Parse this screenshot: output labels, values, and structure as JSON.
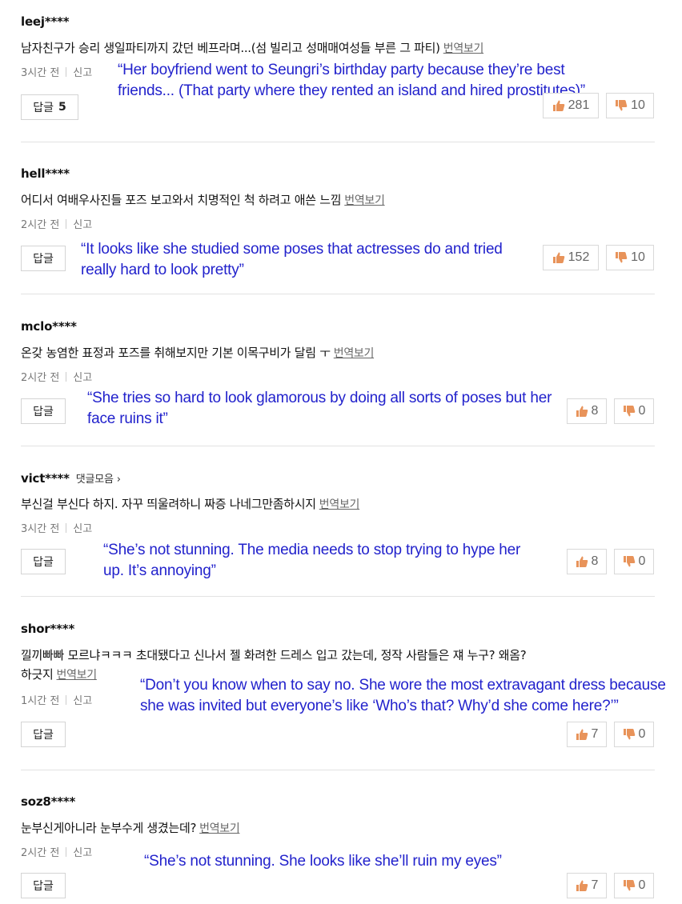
{
  "comments": [
    {
      "author": "leej****",
      "collect_label": "",
      "text_line1": "남자친구가 승리 생일파티까지 갔던 베프라며...(섬 빌리고 성매매여성들 부른 그 파티)",
      "text_line2": "",
      "translate_label": "번역보기",
      "time": "3시간 전",
      "report_label": "신고",
      "reply_label": "답글",
      "reply_count": "5",
      "english": "“Her boyfriend went to Seungri’s birthday party because they’re best friends... (That party where they rented an island and hired prostitutes)”",
      "likes": "281",
      "dislikes": "10"
    },
    {
      "author": "hell****",
      "collect_label": "",
      "text_line1": "어디서 여배우사진들 포즈 보고와서 치명적인 척 하려고 애쓴 느낌",
      "text_line2": "",
      "translate_label": "번역보기",
      "time": "2시간 전",
      "report_label": "신고",
      "reply_label": "답글",
      "reply_count": "",
      "english": "“It looks like she studied some poses that actresses do and tried really hard to look pretty”",
      "likes": "152",
      "dislikes": "10"
    },
    {
      "author": "mclo****",
      "collect_label": "",
      "text_line1": "온갖 농염한 표정과 포즈를 취해보지만 기본 이목구비가 달림 ㅜ",
      "text_line2": "",
      "translate_label": "번역보기",
      "time": "2시간 전",
      "report_label": "신고",
      "reply_label": "답글",
      "reply_count": "",
      "english": "“She tries so hard to look glamorous by doing all sorts of poses but her face ruins it”",
      "likes": "8",
      "dislikes": "0"
    },
    {
      "author": "vict****",
      "collect_label": "댓글모음 ›",
      "text_line1": "부신걸 부신다 하지. 자꾸 띄울려하니 짜증 나네그만좀하시지",
      "text_line2": "",
      "translate_label": "번역보기",
      "time": "3시간 전",
      "report_label": "신고",
      "reply_label": "답글",
      "reply_count": "",
      "english": "“She’s not stunning. The media needs to stop trying to hype her up. It’s annoying”",
      "likes": "8",
      "dislikes": "0"
    },
    {
      "author": "shor****",
      "collect_label": "",
      "text_line1": "낄끼빠빠 모르냐ㅋㅋㅋ 초대됐다고 신나서 젤 화려한 드레스 입고 갔는데, 정작 사람들은 쟤 누구? 왜옴?",
      "text_line2": "하긋지",
      "translate_label": "번역보기",
      "time": "1시간 전",
      "report_label": "신고",
      "reply_label": "답글",
      "reply_count": "",
      "english": "“Don’t you know when to say no. She wore the most extravagant dress because she was invited but everyone’s like ‘Who’s that? Why’d she come here?’”",
      "likes": "7",
      "dislikes": "0"
    },
    {
      "author": "soz8****",
      "collect_label": "",
      "text_line1": "눈부신게아니라 눈부수게 생겼는데?",
      "text_line2": "",
      "translate_label": "번역보기",
      "time": "2시간 전",
      "report_label": "신고",
      "reply_label": "답글",
      "reply_count": "",
      "english": "“She’s not stunning. She looks like she’ll ruin my eyes”",
      "likes": "7",
      "dislikes": "0"
    }
  ],
  "colors": {
    "english_text": "#2222cc",
    "like_icon": "#e8935a",
    "dislike_icon": "#e8935a"
  },
  "icons": {
    "like": "thumbs-up-icon",
    "dislike": "thumbs-down-icon"
  }
}
